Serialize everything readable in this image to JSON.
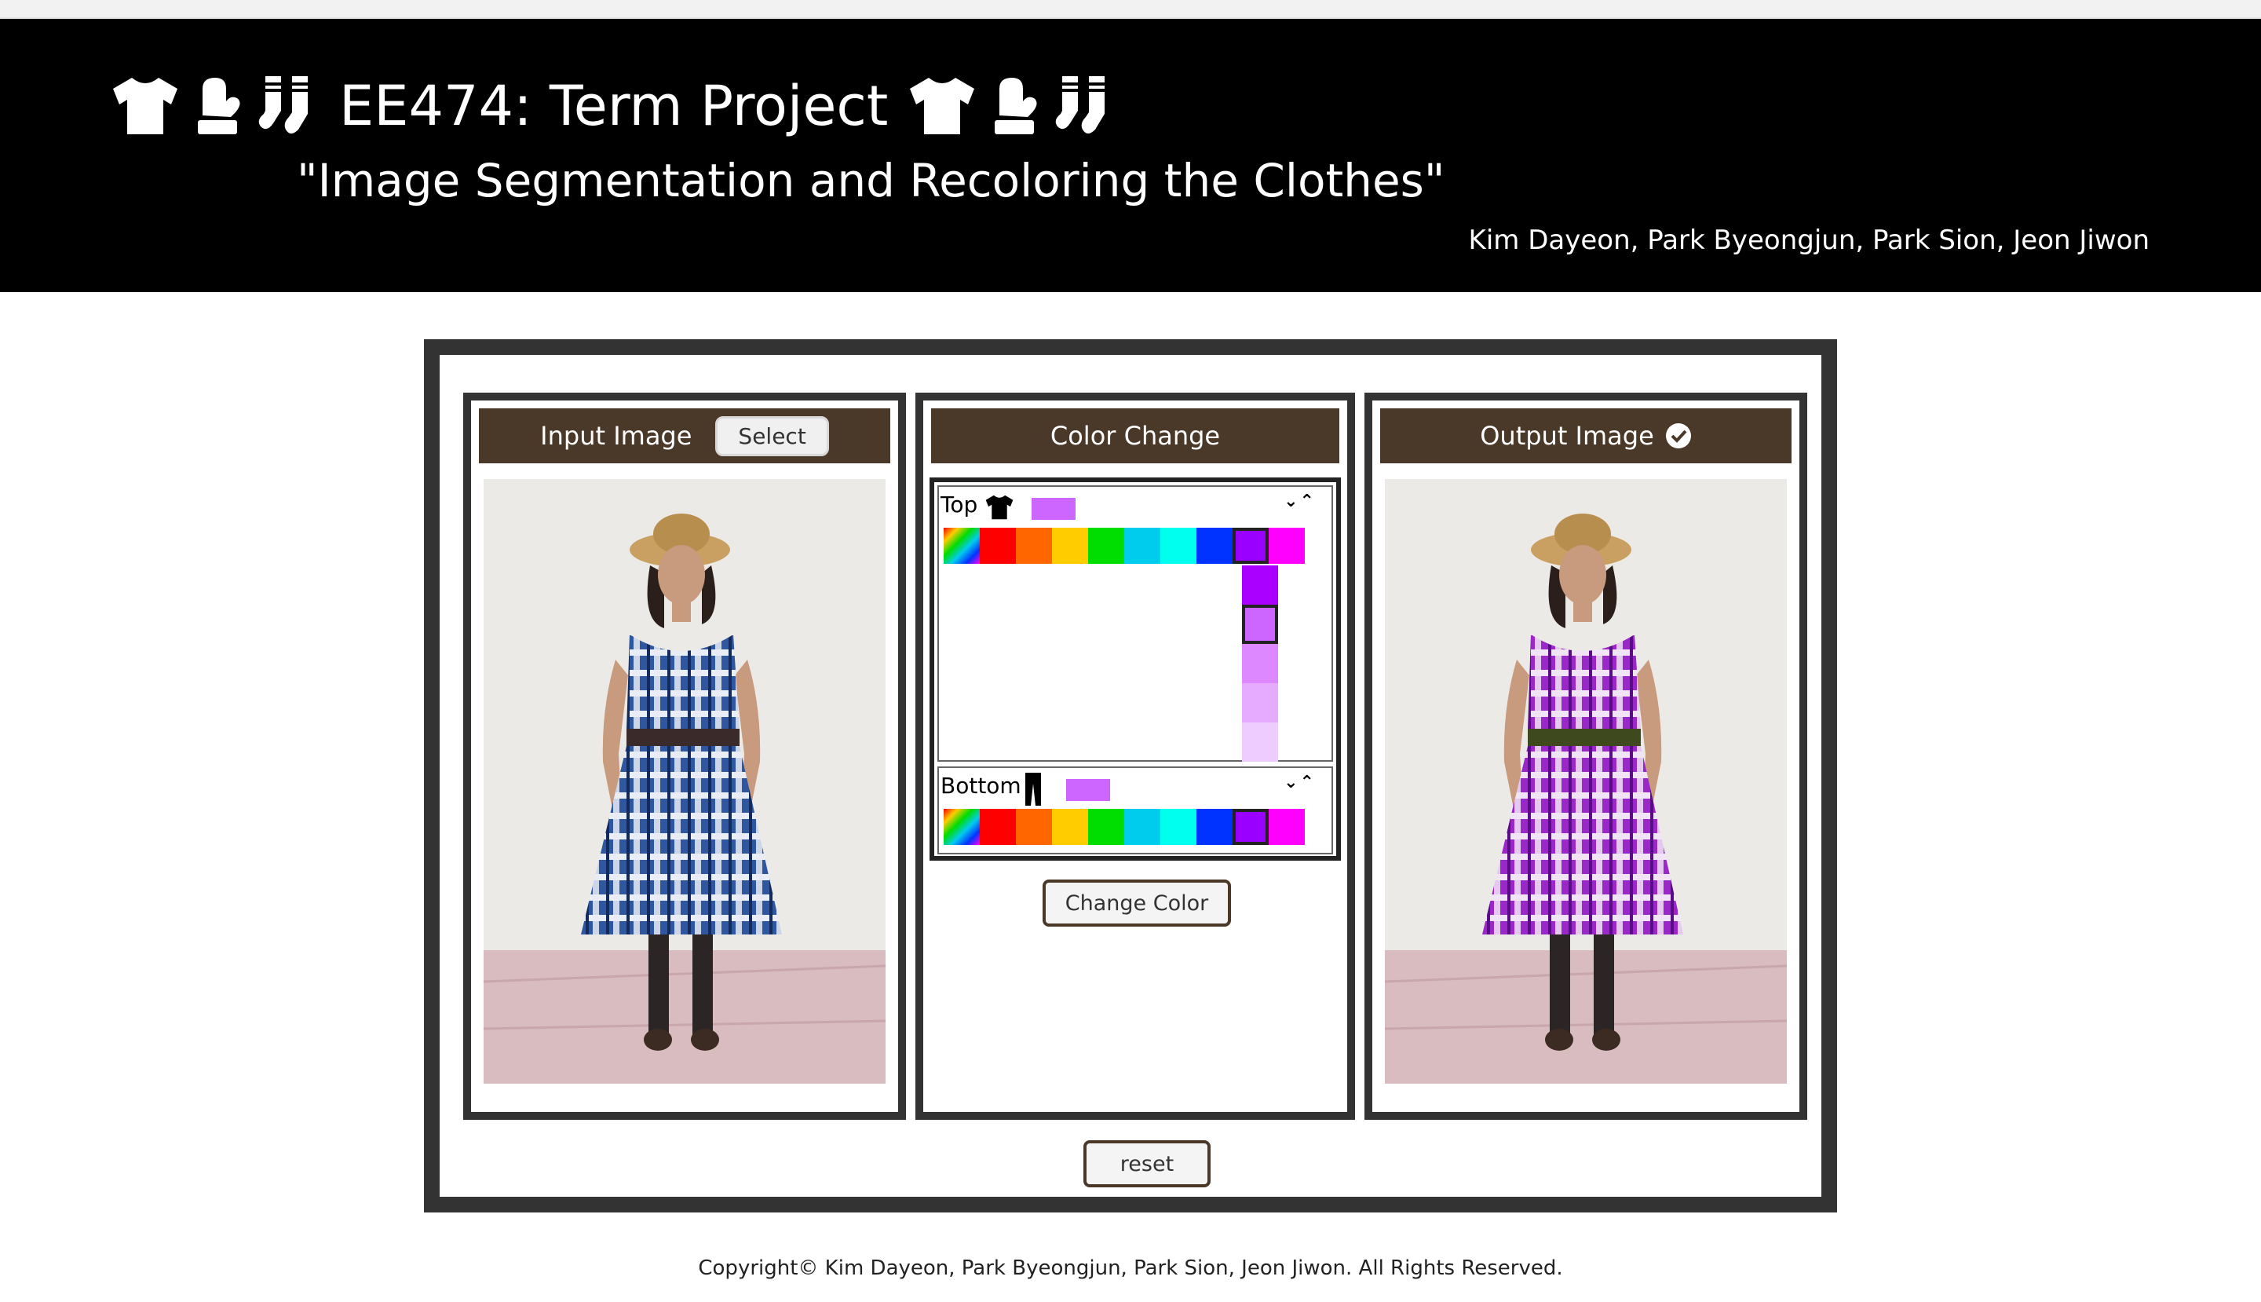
{
  "header": {
    "title": "EE474: Term Project",
    "subtitle": "\"Image Segmentation and Recoloring the Clothes\"",
    "authors": "Kim Dayeon, Park Byeongjun, Park Sion, Jeon Jiwon",
    "icons": [
      "tshirt-icon",
      "mitten-icon",
      "socks-icon"
    ]
  },
  "input_panel": {
    "title": "Input Image",
    "select_label": "Select"
  },
  "color_panel": {
    "title": "Color Change",
    "top": {
      "label": "Top",
      "icon": "tshirt-icon",
      "selected_color": "#cc66ff",
      "palette": [
        "gradient",
        "#ff0000",
        "#ff6600",
        "#ffcc00",
        "#00dd00",
        "#00ccee",
        "#00ffee",
        "#0033ff",
        "#9900ff",
        "#ff00ff"
      ],
      "selected_palette_index": 8,
      "shades": [
        "#aa00ff",
        "#cc66ff",
        "#dd88ff",
        "#e6aaff",
        "#eeccff"
      ],
      "selected_shade_index": 1
    },
    "bottom": {
      "label": "Bottom",
      "icon": "pants-icon",
      "selected_color": "#cc66ff",
      "palette": [
        "gradient",
        "#ff0000",
        "#ff6600",
        "#ffcc00",
        "#00dd00",
        "#00ccee",
        "#00ffee",
        "#0033ff",
        "#9900ff",
        "#ff00ff"
      ],
      "selected_palette_index": 8
    },
    "change_label": "Change Color"
  },
  "output_panel": {
    "title": "Output Image"
  },
  "reset_label": "reset",
  "footer": "Copyright© Kim Dayeon, Park Byeongjun, Park Sion, Jeon Jiwon. All Rights Reserved."
}
